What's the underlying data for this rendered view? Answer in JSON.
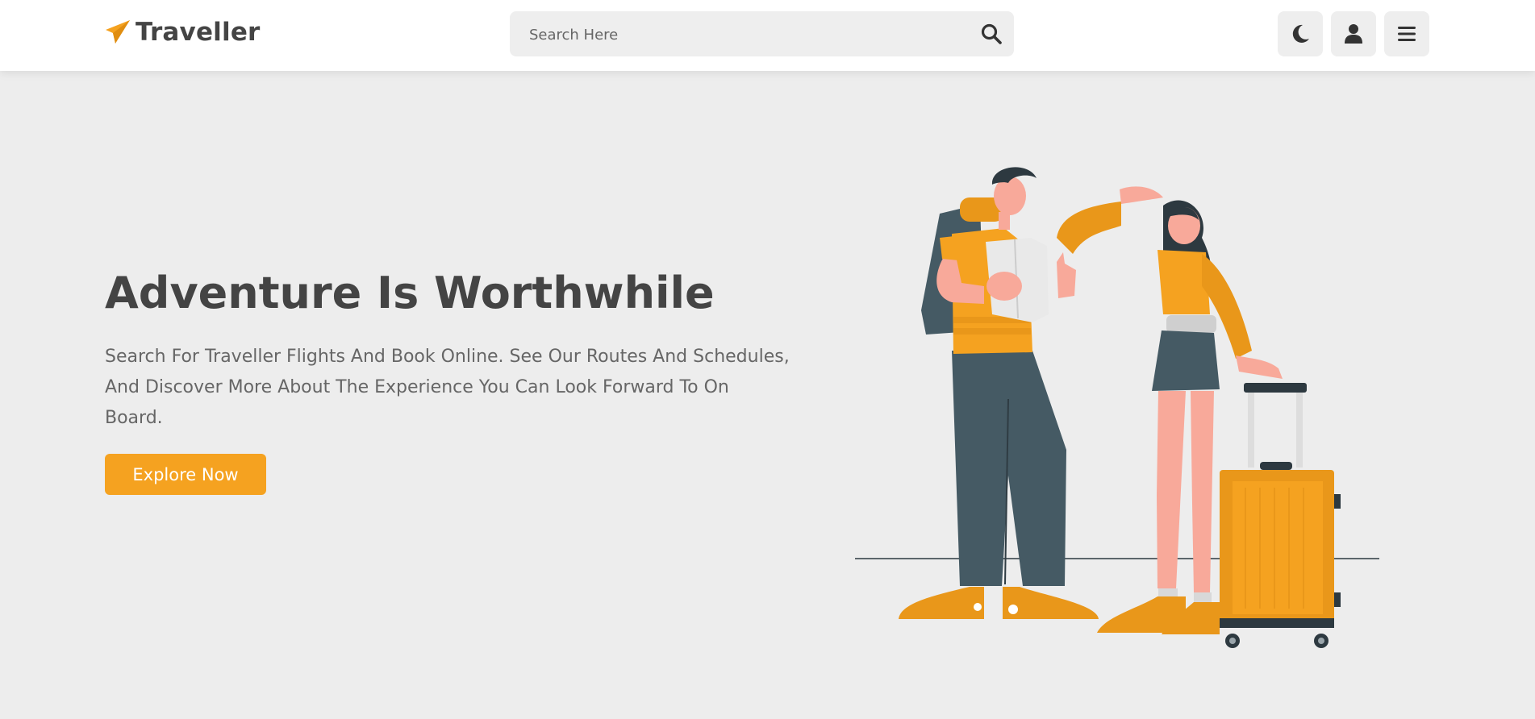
{
  "header": {
    "logo_text": "Traveller",
    "logo_icon": "paper-plane-icon",
    "search": {
      "placeholder": "Search Here",
      "icon": "search-icon"
    },
    "actions": [
      {
        "icon": "moon-icon",
        "label": "dark mode"
      },
      {
        "icon": "user-icon",
        "label": "account"
      },
      {
        "icon": "menu-icon",
        "label": "menu"
      }
    ]
  },
  "hero": {
    "title": "Adventure Is Worthwhile",
    "description": "Search For Traveller Flights And Book Online. See Our Routes And Schedules, And Discover More About The Experience You Can Look Forward To On Board.",
    "cta_label": "Explore Now"
  },
  "colors": {
    "accent": "#f5a220",
    "text_dark": "#444444",
    "text_muted": "#666666",
    "background": "#ededed",
    "header_bg": "#ffffff"
  }
}
